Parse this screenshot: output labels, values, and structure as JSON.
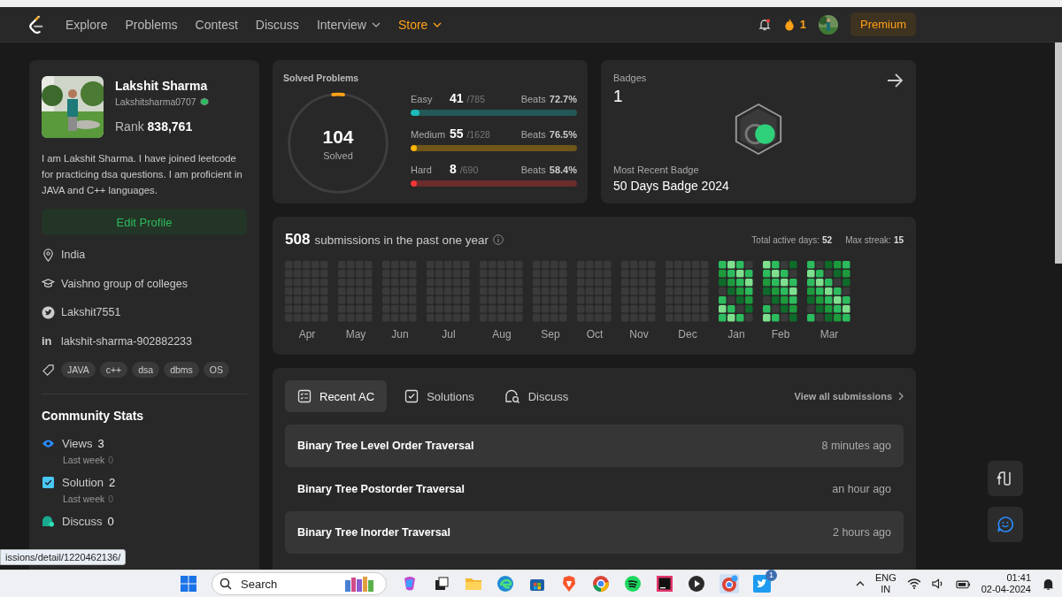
{
  "nav": {
    "items": [
      {
        "label": "Explore",
        "dropdown": false,
        "highlight": false
      },
      {
        "label": "Problems",
        "dropdown": false,
        "highlight": false
      },
      {
        "label": "Contest",
        "dropdown": false,
        "highlight": false
      },
      {
        "label": "Discuss",
        "dropdown": false,
        "highlight": false
      },
      {
        "label": "Interview",
        "dropdown": true,
        "highlight": false
      },
      {
        "label": "Store",
        "dropdown": true,
        "highlight": true
      }
    ],
    "streak": "1",
    "premium": "Premium"
  },
  "profile": {
    "name": "Lakshit Sharma",
    "username": "Lakshitsharma0707",
    "rank_label": "Rank",
    "rank": "838,761",
    "bio": "I am Lakshit Sharma. I have joined leetcode for practicing dsa questions. I am proficient in JAVA and C++ languages.",
    "edit_button": "Edit Profile",
    "details": [
      {
        "kind": "location",
        "text": "India"
      },
      {
        "kind": "school",
        "text": "Vaishno group of colleges"
      },
      {
        "kind": "twitter",
        "text": "Lakshit7551"
      },
      {
        "kind": "linkedin",
        "icon": "in",
        "text": "lakshit-sharma-902882233"
      }
    ],
    "skills": [
      "JAVA",
      "c++",
      "dsa",
      "dbms",
      "OS"
    ]
  },
  "community": {
    "title": "Community Stats",
    "items": [
      {
        "kind": "views",
        "label": "Views",
        "value": "3",
        "sub_label": "Last week",
        "sub_value": "0"
      },
      {
        "kind": "solution",
        "label": "Solution",
        "value": "2",
        "sub_label": "Last week",
        "sub_value": "0"
      },
      {
        "kind": "discuss",
        "label": "Discuss",
        "value": "0"
      }
    ]
  },
  "solved": {
    "title": "Solved Problems",
    "total": "104",
    "total_label": "Solved",
    "level": 0.034,
    "rows": [
      {
        "label": "Easy",
        "solved": "41",
        "total": "/785",
        "beats_label": "Beats",
        "beats": "72.7%",
        "level": 0.052,
        "color": "#1cbaba"
      },
      {
        "label": "Medium",
        "solved": "55",
        "total": "/1628",
        "beats_label": "Beats",
        "beats": "76.5%",
        "level": 0.034,
        "color": "#ffb700"
      },
      {
        "label": "Hard",
        "solved": "8",
        "total": "/690",
        "beats_label": "Beats",
        "beats": "58.4%",
        "level": 0.012,
        "color": "#f63737"
      }
    ]
  },
  "badges": {
    "title": "Badges",
    "count": "1",
    "recent_label": "Most Recent Badge",
    "recent": "50 Days Badge 2024"
  },
  "activity": {
    "count": "508",
    "text": "submissions in the past one year",
    "active_label": "Total active days:",
    "active": "52",
    "streak_label": "Max streak:",
    "streak": "15",
    "months": [
      "Apr",
      "May",
      "Jun",
      "Jul",
      "Aug",
      "Sep",
      "Oct",
      "Nov",
      "Dec",
      "Jan",
      "Feb",
      "Mar"
    ]
  },
  "tabs": [
    {
      "kind": "list",
      "label": "Recent AC",
      "selected": true
    },
    {
      "kind": "check",
      "label": "Solutions",
      "selected": false
    },
    {
      "kind": "discuss",
      "label": "Discuss",
      "selected": false
    }
  ],
  "view_all": "View all submissions",
  "submissions": [
    {
      "title": "Binary Tree Level Order Traversal",
      "time": "8 minutes ago"
    },
    {
      "title": "Binary Tree Postorder Traversal",
      "time": "an hour ago"
    },
    {
      "title": "Binary Tree Inorder Traversal",
      "time": "2 hours ago"
    }
  ],
  "status_url": "issions/detail/1220462136/",
  "taskbar": {
    "search": "Search",
    "lang": "ENG",
    "region": "IN",
    "time": "01:41",
    "date": "02-04-2024",
    "twitter_badge": "1"
  }
}
